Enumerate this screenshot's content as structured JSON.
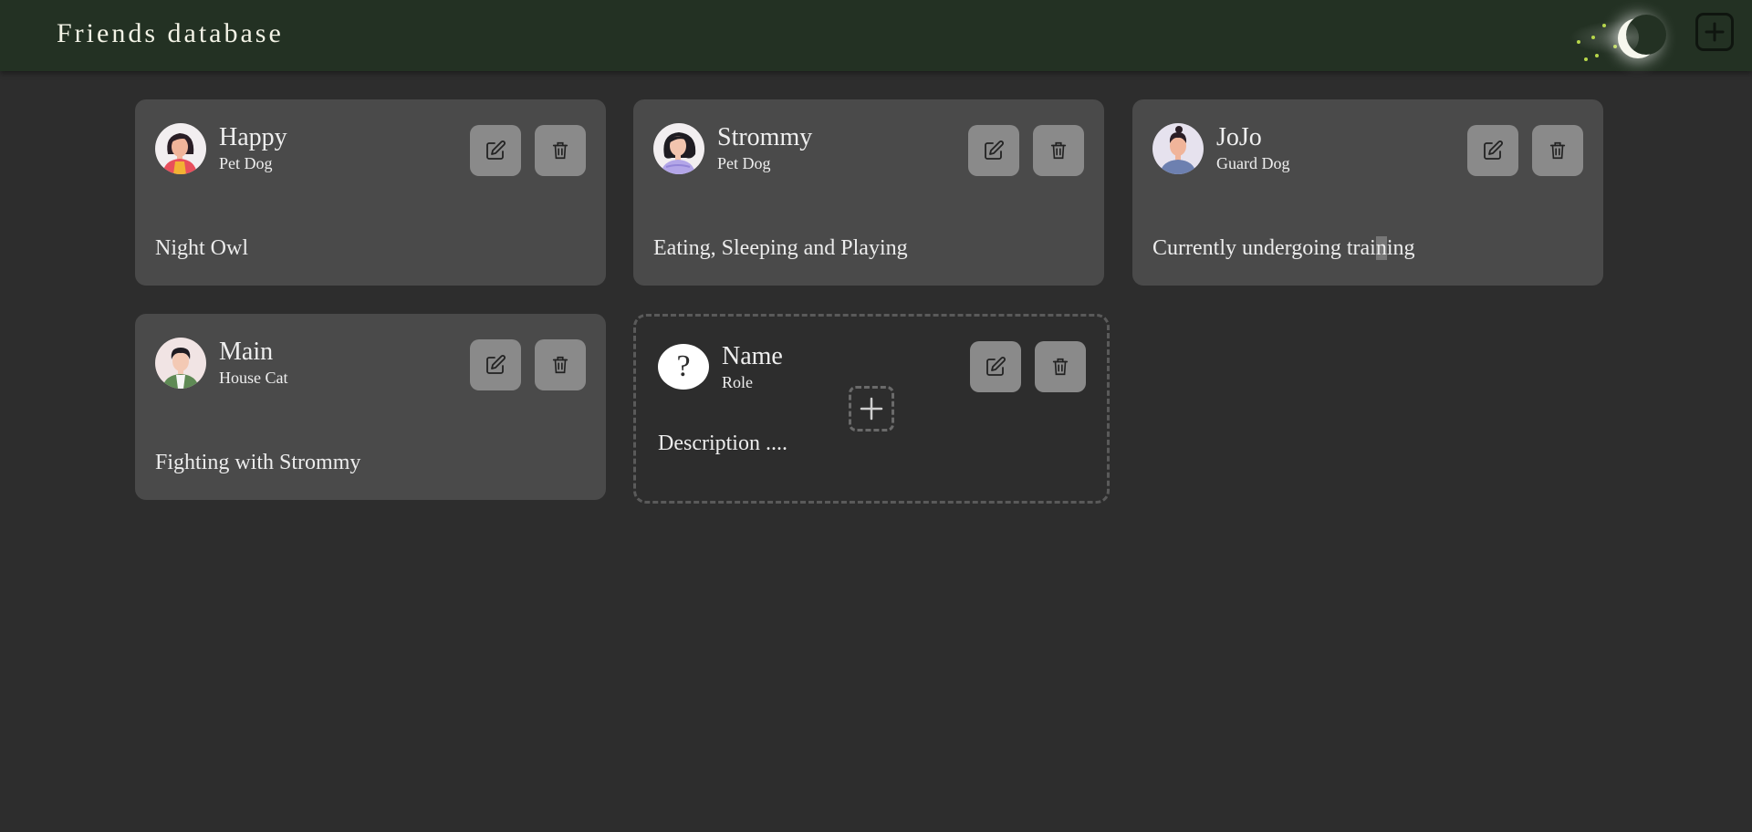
{
  "header": {
    "title": "Friends database",
    "theme_toggle_icon": "moon-icon",
    "add_icon": "plus-square-icon"
  },
  "friends": [
    {
      "name": "Happy",
      "role": "Pet Dog",
      "description": "Night Owl",
      "avatar_icon": "avatar-woman-icon"
    },
    {
      "name": "Strommy",
      "role": "Pet Dog",
      "description": "Eating, Sleeping and Playing",
      "avatar_icon": "avatar-woman-icon"
    },
    {
      "name": "JoJo",
      "role": "Guard Dog",
      "description_start": "Currently undergoing trai",
      "description_highlight": "n",
      "description_end": "ing",
      "avatar_icon": "avatar-man-icon"
    },
    {
      "name": "Main",
      "role": "House Cat",
      "description": "Fighting with Strommy",
      "avatar_icon": "avatar-man-icon"
    }
  ],
  "new_friend": {
    "avatar_symbol": "?",
    "name_placeholder": "Name",
    "role_placeholder": "Role",
    "description_placeholder": "Description ....",
    "create_icon": "plus-icon"
  },
  "icons": {
    "edit": "edit-icon",
    "delete": "trash-icon"
  },
  "colors": {
    "header_bg": "#233123",
    "page_bg": "#2d2d2d",
    "card_bg": "#4a4a4a",
    "button_bg": "#8a8a8a",
    "moon": "#f7f7ee",
    "stars": "#b6d64a"
  }
}
